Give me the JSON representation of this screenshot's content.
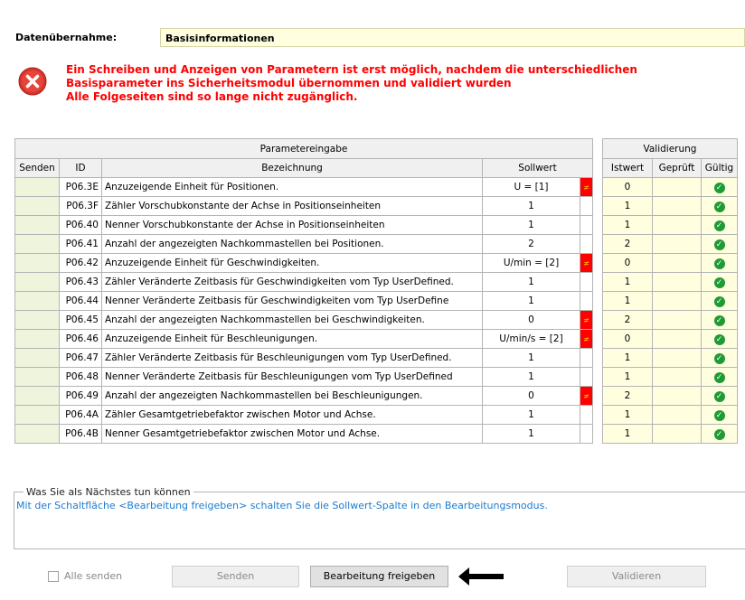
{
  "takeover": {
    "label": "Datenübernahme:",
    "value": "Basisinformationen"
  },
  "error": {
    "icon": "error-x-icon",
    "line1": "Ein Schreiben und Anzeigen von Parametern ist erst möglich, nachdem die unterschiedlichen",
    "line2": "Basisparameter ins Sicherheitsmodul übernommen und validiert wurden",
    "line3": "Alle Folgeseiten sind so lange nicht zugänglich."
  },
  "table": {
    "group_input": "Parametereingabe",
    "group_validation": "Validierung",
    "headers": {
      "send": "Senden",
      "id": "ID",
      "name": "Bezeichnung",
      "soll": "Sollwert",
      "ist": "Istwert",
      "geprueft": "Geprüft",
      "gueltig": "Gültig"
    },
    "rows": [
      {
        "id": "P06.3E",
        "name": "Anzuzeigende Einheit für Positionen.",
        "soll": "U = [1]",
        "diff": "≠",
        "ist": "0",
        "valid": true
      },
      {
        "id": "P06.3F",
        "name": "Zähler Vorschubkonstante der Achse in Positionseinheiten",
        "soll": "1",
        "diff": "",
        "ist": "1",
        "valid": true
      },
      {
        "id": "P06.40",
        "name": "Nenner Vorschubkonstante der Achse in Positionseinheiten",
        "soll": "1",
        "diff": "",
        "ist": "1",
        "valid": true
      },
      {
        "id": "P06.41",
        "name": "Anzahl der angezeigten Nachkommastellen bei Positionen.",
        "soll": "2",
        "diff": "",
        "ist": "2",
        "valid": true
      },
      {
        "id": "P06.42",
        "name": "Anzuzeigende Einheit für Geschwindigkeiten.",
        "soll": "U/min = [2]",
        "diff": "≠",
        "ist": "0",
        "valid": true
      },
      {
        "id": "P06.43",
        "name": "Zähler Veränderte Zeitbasis für Geschwindigkeiten vom Typ UserDefined.",
        "soll": "1",
        "diff": "",
        "ist": "1",
        "valid": true
      },
      {
        "id": "P06.44",
        "name": "Nenner Veränderte Zeitbasis für Geschwindigkeiten vom Typ UserDefine",
        "soll": "1",
        "diff": "",
        "ist": "1",
        "valid": true
      },
      {
        "id": "P06.45",
        "name": "Anzahl der angezeigten Nachkommastellen bei Geschwindigkeiten.",
        "soll": "0",
        "diff": "≠",
        "ist": "2",
        "valid": true
      },
      {
        "id": "P06.46",
        "name": "Anzuzeigende Einheit für Beschleunigungen.",
        "soll": "U/min/s = [2]",
        "diff": "≠",
        "ist": "0",
        "valid": true
      },
      {
        "id": "P06.47",
        "name": "Zähler Veränderte Zeitbasis für Beschleunigungen vom Typ UserDefined.",
        "soll": "1",
        "diff": "",
        "ist": "1",
        "valid": true
      },
      {
        "id": "P06.48",
        "name": "Nenner Veränderte Zeitbasis für Beschleunigungen vom Typ UserDefined",
        "soll": "1",
        "diff": "",
        "ist": "1",
        "valid": true
      },
      {
        "id": "P06.49",
        "name": "Anzahl der angezeigten Nachkommastellen bei Beschleunigungen.",
        "soll": "0",
        "diff": "≠",
        "ist": "2",
        "valid": true
      },
      {
        "id": "P06.4A",
        "name": "Zähler Gesamtgetriebefaktor zwischen Motor und Achse.",
        "soll": "1",
        "diff": "",
        "ist": "1",
        "valid": true
      },
      {
        "id": "P06.4B",
        "name": "Nenner Gesamtgetriebefaktor zwischen Motor und Achse.",
        "soll": "1",
        "diff": "",
        "ist": "1",
        "valid": true
      }
    ]
  },
  "next_steps": {
    "legend": "Was Sie als Nächstes tun können",
    "text": "Mit der Schaltfläche <Bearbeitung freigeben> schalten Sie die Sollwert-Spalte in den Bearbeitungsmodus."
  },
  "footer": {
    "send_all_label": "Alle senden",
    "send_button": "Senden",
    "edit_button": "Bearbeitung freigeben",
    "validate_button": "Validieren"
  },
  "colors": {
    "error": "#ff0000",
    "diff_flag": "#ff0000",
    "valid_check": "#1f9a34",
    "link_text": "#1a7bd0",
    "readonly_cell": "#ffffe0",
    "send_cell": "#eef5dc"
  }
}
